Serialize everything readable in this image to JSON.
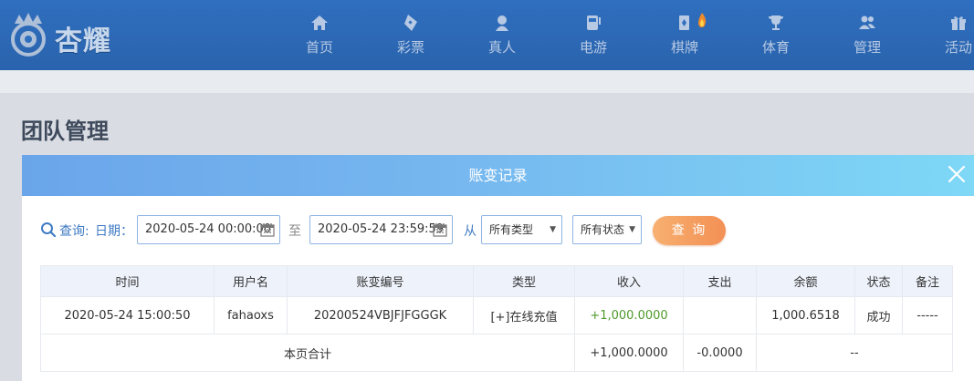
{
  "brand": {
    "name": "杏耀"
  },
  "nav": [
    {
      "label": "首页",
      "icon": "home-icon"
    },
    {
      "label": "彩票",
      "icon": "lottery-icon"
    },
    {
      "label": "真人",
      "icon": "live-dealer-icon"
    },
    {
      "label": "电游",
      "icon": "slot-machine-icon"
    },
    {
      "label": "棋牌",
      "icon": "cards-icon",
      "badge": "flame-icon"
    },
    {
      "label": "体育",
      "icon": "trophy-icon"
    },
    {
      "label": "管理",
      "icon": "users-icon"
    },
    {
      "label": "活动",
      "icon": "gift-icon"
    }
  ],
  "page": {
    "title": "团队管理"
  },
  "modal": {
    "title": "账变记录"
  },
  "filters": {
    "query_label": "查询:",
    "date_label": "日期：",
    "start": "2020-05-24 00:00:00",
    "to_label": "至",
    "end": "2020-05-24 23:59:59",
    "from_label": "从",
    "type_select": "所有类型",
    "status_select": "所有状态",
    "query_button": "查 询"
  },
  "table": {
    "headers": [
      "时间",
      "用户名",
      "账变编号",
      "类型",
      "收入",
      "支出",
      "余额",
      "状态",
      "备注"
    ],
    "rows": [
      [
        "2020-05-24 15:00:50",
        "fahaoxs",
        "20200524VBJFJFGGGK",
        "[+]在线充值",
        "+1,000.0000",
        "",
        "1,000.6518",
        "成功",
        "-----"
      ]
    ],
    "summary": {
      "label": "本页合计",
      "income": "+1,000.0000",
      "expense": "-0.0000",
      "rest": "--"
    }
  },
  "colors": {
    "nav_bg": "#2f6fbf",
    "accent": "#3f7bc4",
    "income": "#4f9a2c",
    "button": "#f39055"
  }
}
